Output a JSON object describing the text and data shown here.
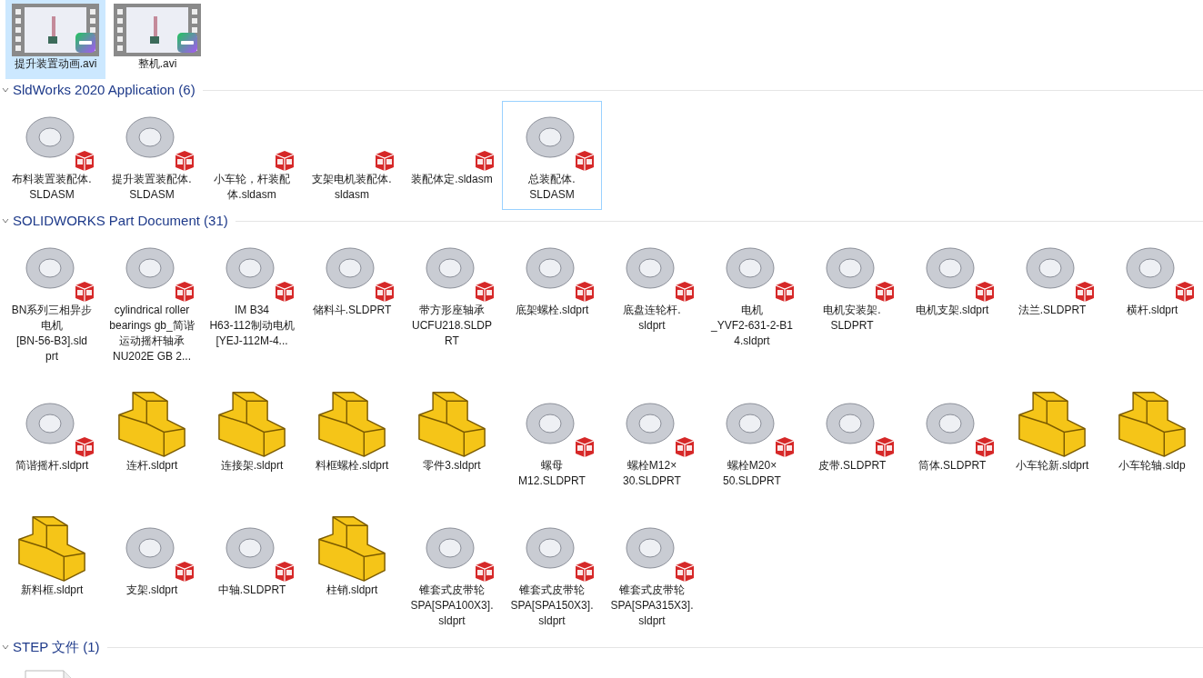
{
  "top_items": [
    {
      "name": "提升装置动画.avi",
      "kind": "video",
      "selected": true,
      "focused": false
    },
    {
      "name": "整机.avi",
      "kind": "video",
      "selected": false,
      "focused": false
    }
  ],
  "groups": [
    {
      "title": "SldWorks 2020 Application (6)",
      "expanded": true,
      "items": [
        {
          "name": "布料装置装配体.\nSLDASM",
          "kind": "assembly",
          "selected": false,
          "focused": false
        },
        {
          "name": "提升装置装配体.\nSLDASM",
          "kind": "assembly",
          "selected": false,
          "focused": false
        },
        {
          "name": "小车轮，杆装配体.sldasm",
          "kind": "assembly-blank",
          "selected": false,
          "focused": false
        },
        {
          "name": "支架电机装配体.\nsldasm",
          "kind": "assembly-blank",
          "selected": false,
          "focused": false
        },
        {
          "name": "装配体定.sldasm",
          "kind": "assembly-blank",
          "selected": false,
          "focused": false
        },
        {
          "name": "总装配体.\nSLDASM",
          "kind": "assembly",
          "selected": false,
          "focused": true
        }
      ]
    },
    {
      "title": "SOLIDWORKS Part Document (31)",
      "expanded": true,
      "items": [
        {
          "name": "BN系列三相异步电机\n[BN-56-B3].sld\nprt",
          "kind": "part",
          "selected": false,
          "focused": false
        },
        {
          "name": "cylindrical roller\nbearings gb_简谐运动摇杆轴承\nNU202E GB 2...",
          "kind": "part",
          "selected": false,
          "focused": false
        },
        {
          "name": "IM B34\nH63-112制动电机\n[YEJ-112M-4...",
          "kind": "part",
          "selected": false,
          "focused": false
        },
        {
          "name": "储料斗.SLDPRT",
          "kind": "part",
          "selected": false,
          "focused": false
        },
        {
          "name": "带方形座轴承\nUCFU218.SLDP\nRT",
          "kind": "part",
          "selected": false,
          "focused": false
        },
        {
          "name": "底架螺栓.sldprt",
          "kind": "part",
          "selected": false,
          "focused": false
        },
        {
          "name": "底盘连轮杆.\nsldprt",
          "kind": "part",
          "selected": false,
          "focused": false
        },
        {
          "name": "电机\n_YVF2-631-2-B1\n4.sldprt",
          "kind": "part",
          "selected": false,
          "focused": false
        },
        {
          "name": "电机安装架.\nSLDPRT",
          "kind": "part",
          "selected": false,
          "focused": false
        },
        {
          "name": "电机支架.sldprt",
          "kind": "part",
          "selected": false,
          "focused": false
        },
        {
          "name": "法兰.SLDPRT",
          "kind": "part",
          "selected": false,
          "focused": false
        },
        {
          "name": "横杆.sldprt",
          "kind": "part",
          "selected": false,
          "focused": false
        },
        {
          "name": "简谐摇杆.sldprt",
          "kind": "part",
          "selected": false,
          "focused": false
        },
        {
          "name": "连杆.sldprt",
          "kind": "generic",
          "selected": false,
          "focused": false
        },
        {
          "name": "连接架.sldprt",
          "kind": "generic",
          "selected": false,
          "focused": false
        },
        {
          "name": "料框螺栓.sldprt",
          "kind": "generic",
          "selected": false,
          "focused": false
        },
        {
          "name": "零件3.sldprt",
          "kind": "generic",
          "selected": false,
          "focused": false
        },
        {
          "name": "螺母\nM12.SLDPRT",
          "kind": "part",
          "selected": false,
          "focused": false
        },
        {
          "name": "螺栓M12×\n30.SLDPRT",
          "kind": "part",
          "selected": false,
          "focused": false
        },
        {
          "name": "螺栓M20×\n50.SLDPRT",
          "kind": "part",
          "selected": false,
          "focused": false
        },
        {
          "name": "皮带.SLDPRT",
          "kind": "part",
          "selected": false,
          "focused": false
        },
        {
          "name": "筒体.SLDPRT",
          "kind": "part",
          "selected": false,
          "focused": false
        },
        {
          "name": "小车轮新.sldprt",
          "kind": "generic",
          "selected": false,
          "focused": false
        },
        {
          "name": "小车轮轴.sldp",
          "kind": "generic",
          "selected": false,
          "focused": false
        },
        {
          "name": "新料框.sldprt",
          "kind": "generic",
          "selected": false,
          "focused": false
        },
        {
          "name": "支架.sldprt",
          "kind": "part",
          "selected": false,
          "focused": false
        },
        {
          "name": "中轴.SLDPRT",
          "kind": "part",
          "selected": false,
          "focused": false
        },
        {
          "name": "柱销.sldprt",
          "kind": "generic",
          "selected": false,
          "focused": false
        },
        {
          "name": "锥套式皮带轮\nSPA[SPA100X3].\nsldprt",
          "kind": "part",
          "selected": false,
          "focused": false
        },
        {
          "name": "锥套式皮带轮\nSPA[SPA150X3].\nsldprt",
          "kind": "part",
          "selected": false,
          "focused": false
        },
        {
          "name": "锥套式皮带轮\nSPA[SPA315X3].\nsldprt",
          "kind": "part",
          "selected": false,
          "focused": false
        }
      ]
    },
    {
      "title": "STEP 文件 (1)",
      "expanded": true,
      "items": [
        {
          "kind": "document",
          "selected": false,
          "focused": false
        }
      ]
    }
  ]
}
